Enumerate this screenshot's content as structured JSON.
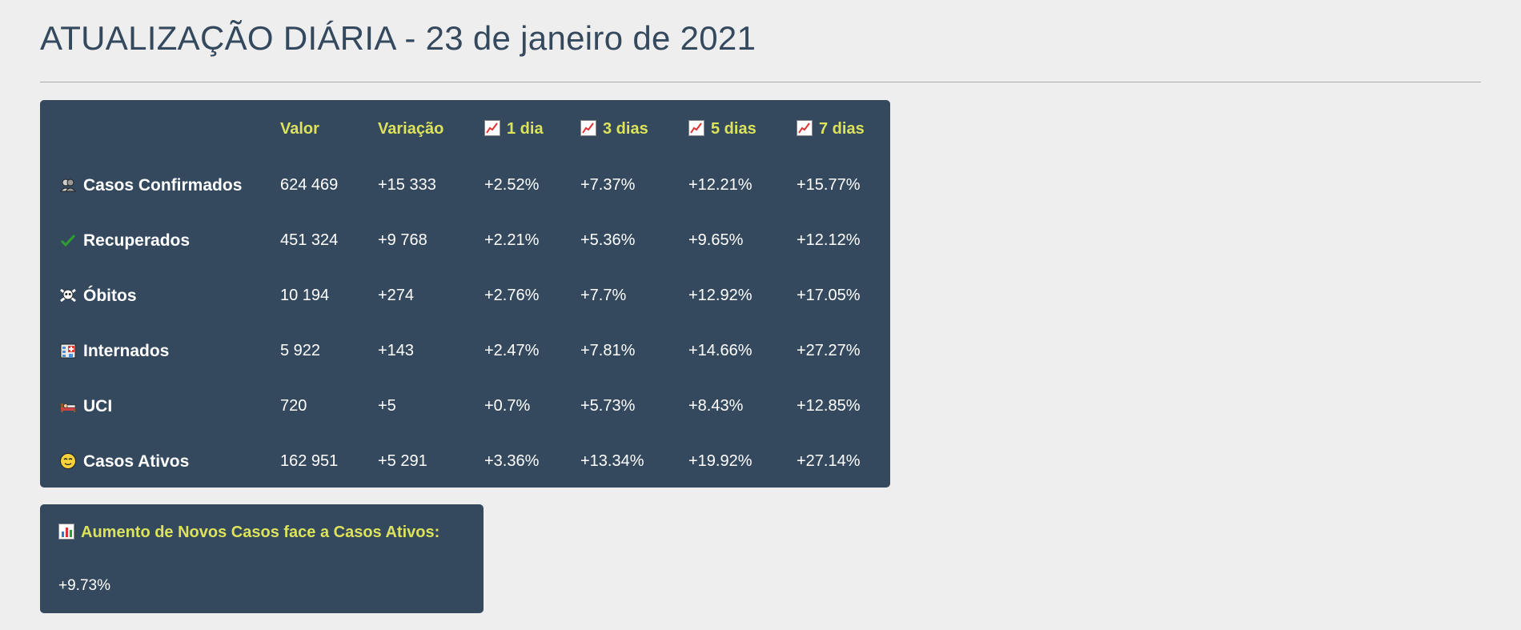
{
  "page": {
    "title": "ATUALIZAÇÃO DIÁRIA - 23 de janeiro de 2021"
  },
  "table": {
    "headers": {
      "valor": "Valor",
      "variacao": "Variação",
      "d1": "1 dia",
      "d3": "3 dias",
      "d5": "5 dias",
      "d7": "7 dias"
    },
    "rows": [
      {
        "icon": "people-icon",
        "label": "Casos Confirmados",
        "valor": "624 469",
        "variacao": "+15 333",
        "d1": "+2.52%",
        "d3": "+7.37%",
        "d5": "+12.21%",
        "d7": "+15.77%"
      },
      {
        "icon": "check-mark-icon",
        "label": "Recuperados",
        "valor": "451 324",
        "variacao": "+9 768",
        "d1": "+2.21%",
        "d3": "+5.36%",
        "d5": "+9.65%",
        "d7": "+12.12%"
      },
      {
        "icon": "skull-crossbones-icon",
        "label": "Óbitos",
        "valor": "10 194",
        "variacao": "+274",
        "d1": "+2.76%",
        "d3": "+7.7%",
        "d5": "+12.92%",
        "d7": "+17.05%"
      },
      {
        "icon": "hospital-icon",
        "label": "Internados",
        "valor": "5 922",
        "variacao": "+143",
        "d1": "+2.47%",
        "d3": "+7.81%",
        "d5": "+14.66%",
        "d7": "+27.27%"
      },
      {
        "icon": "bed-icon",
        "label": "UCI",
        "valor": "720",
        "variacao": "+5",
        "d1": "+0.7%",
        "d3": "+5.73%",
        "d5": "+8.43%",
        "d7": "+12.85%"
      },
      {
        "icon": "face-icon",
        "label": "Casos Ativos",
        "valor": "162 951",
        "variacao": "+5 291",
        "d1": "+3.36%",
        "d3": "+13.34%",
        "d5": "+19.92%",
        "d7": "+27.14%"
      }
    ]
  },
  "summary": {
    "icon": "bar-chart-icon",
    "title": "Aumento de Novos Casos face a Casos Ativos:",
    "value": "+9.73%"
  },
  "colors": {
    "background": "#eeeeee",
    "card": "#34495e",
    "accent": "#dce35b",
    "title": "#34495e",
    "text": "#ffffff"
  }
}
